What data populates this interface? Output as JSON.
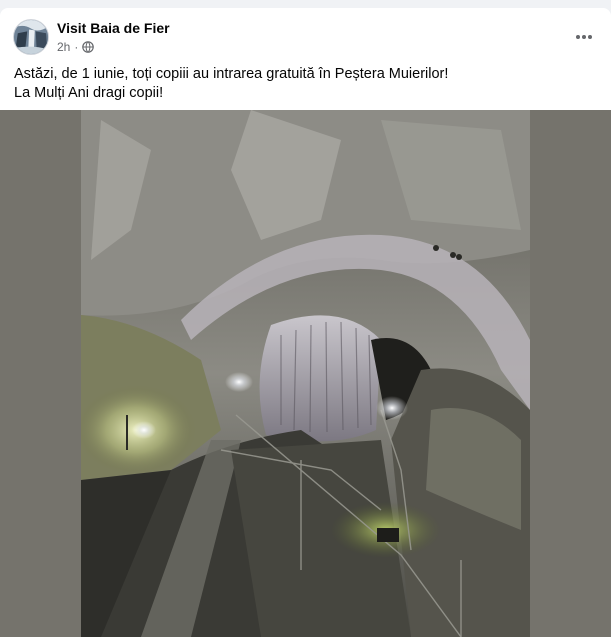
{
  "post": {
    "page_name": "Visit Baia de Fier",
    "time": "2h",
    "audience_icon": "globe-icon",
    "more_icon": "more-options-icon",
    "lines": [
      "Astăzi, de 1 iunie, toți copiii au intrarea gratuită în Peștera Muierilor!",
      "La Mulți Ani dragi copii!"
    ]
  },
  "colors": {
    "page_background": "#f0f2f5",
    "card_background": "#ffffff",
    "secondary_text": "#65676b",
    "photo_frame": "#75736c"
  }
}
